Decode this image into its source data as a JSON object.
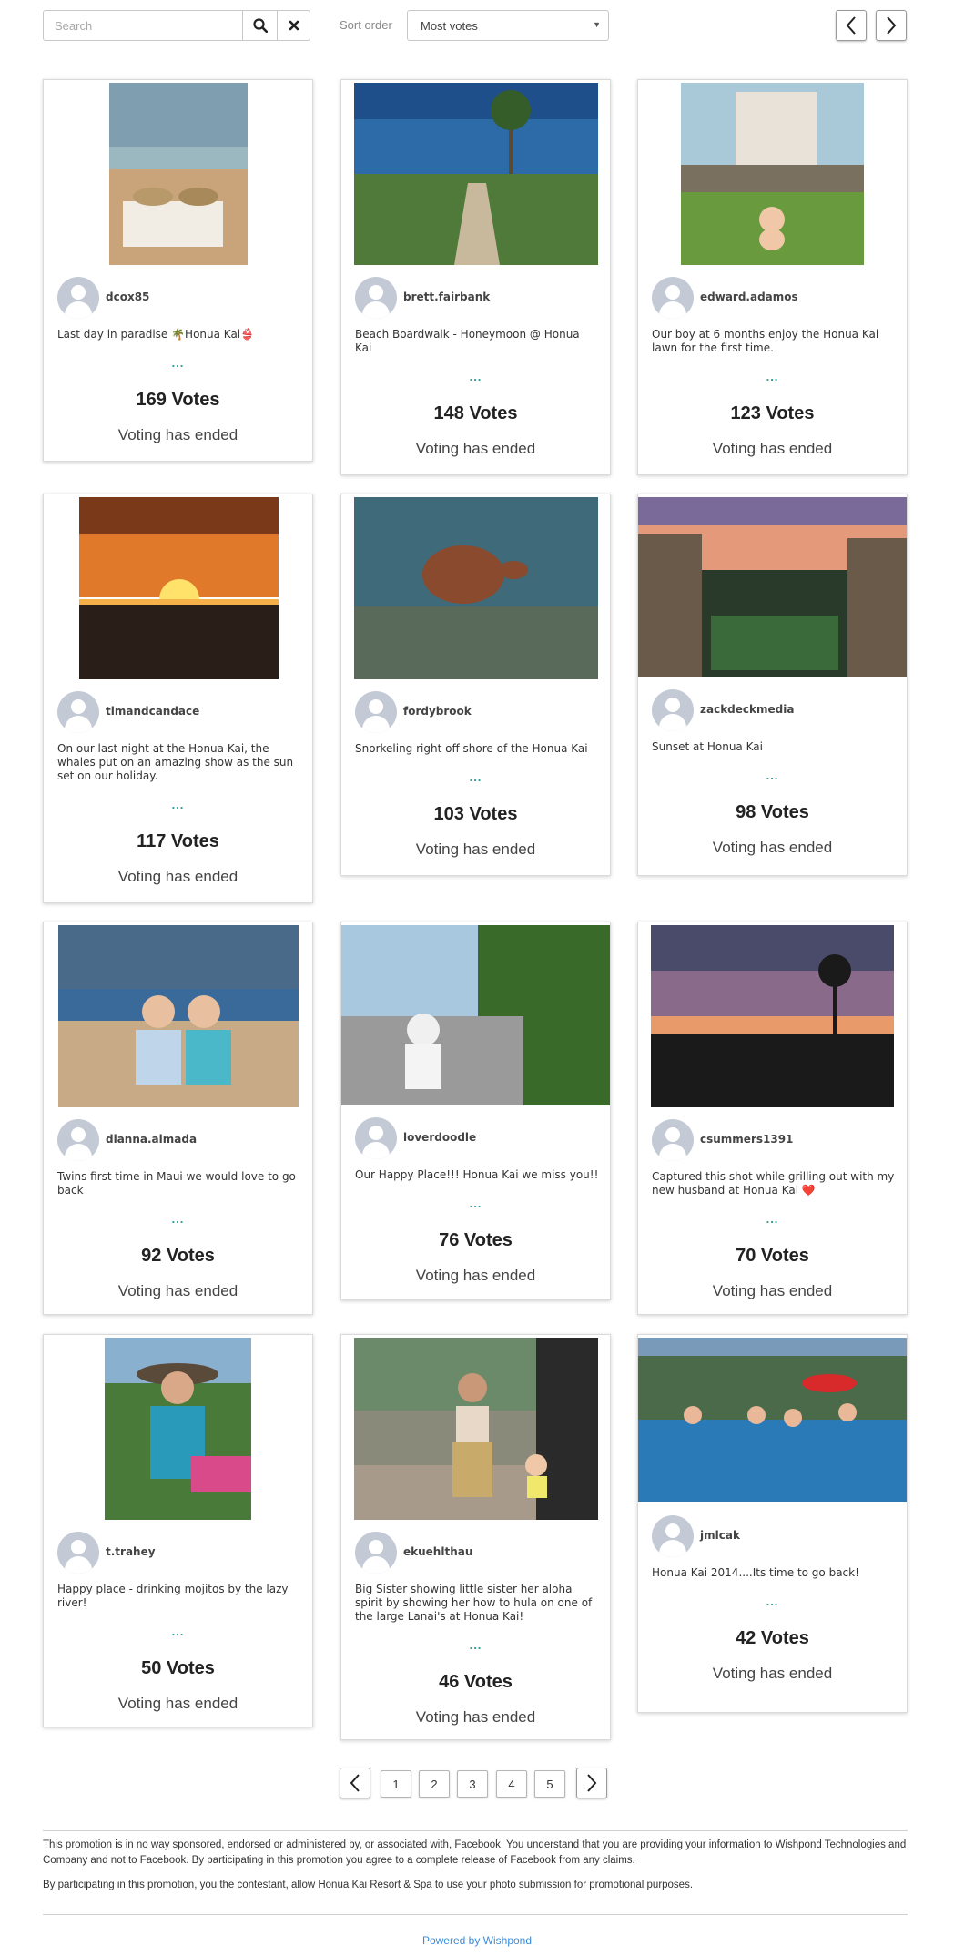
{
  "toolbar": {
    "search_placeholder": "Search",
    "sort_label": "Sort order",
    "sort_value": "Most votes"
  },
  "entries": [
    {
      "username": "dcox85",
      "caption": "Last day in paradise 🌴Honua Kai👙",
      "votes": "169 Votes",
      "status": "Voting has ended"
    },
    {
      "username": "brett.fairbank",
      "caption": "Beach Boardwalk - Honeymoon @ Honua Kai",
      "votes": "148 Votes",
      "status": "Voting has ended"
    },
    {
      "username": "edward.adamos",
      "caption": "Our boy at 6 months enjoy the Honua Kai lawn for the first time.",
      "votes": "123 Votes",
      "status": "Voting has ended"
    },
    {
      "username": "timandcandace",
      "caption": "On our last night at the Honua Kai, the whales put on an amazing show as the sun set on our holiday.",
      "votes": "117 Votes",
      "status": "Voting has ended"
    },
    {
      "username": "fordybrook",
      "caption": "Snorkeling right off shore of the Honua Kai",
      "votes": "103 Votes",
      "status": "Voting has ended"
    },
    {
      "username": "zackdeckmedia",
      "caption": "Sunset at Honua Kai",
      "votes": "98 Votes",
      "status": "Voting has ended"
    },
    {
      "username": "dianna.almada",
      "caption": "Twins first time in Maui we would love to go back",
      "votes": "92 Votes",
      "status": "Voting has ended"
    },
    {
      "username": "loverdoodle",
      "caption": "Our Happy Place!!! Honua Kai we miss you!!",
      "votes": "76 Votes",
      "status": "Voting has ended"
    },
    {
      "username": "csummers1391",
      "caption": "Captured this shot while grilling out with my new husband at Honua Kai ❤️",
      "votes": "70 Votes",
      "status": "Voting has ended"
    },
    {
      "username": "t.trahey",
      "caption": "Happy place - drinking mojitos by the lazy river!",
      "votes": "50 Votes",
      "status": "Voting has ended"
    },
    {
      "username": "ekuehlthau",
      "caption": "Big Sister showing little sister her aloha spirit by showing her how to hula on one of the large Lanai's at Honua Kai!",
      "votes": "46 Votes",
      "status": "Voting has ended"
    },
    {
      "username": "jmlcak",
      "caption": "Honua Kai 2014....Its time to go back!",
      "votes": "42 Votes",
      "status": "Voting has ended"
    }
  ],
  "more_indicator": "...",
  "pagination": [
    "1",
    "2",
    "3",
    "4",
    "5"
  ],
  "footer": {
    "disclaimer_1": "This promotion is in no way sponsored, endorsed or administered by, or associated with, Facebook. You understand that you are providing your information to Wishpond Technologies and Company and not to Facebook. By participating in this promotion you agree to a complete release of Facebook from any claims.",
    "disclaimer_2": "By participating in this promotion, you the contestant, allow Honua Kai Resort & Spa to use your photo submission for promotional purposes.",
    "powered_by": "Powered by Wishpond"
  },
  "colors": {
    "accent_teal": "#2a9d8f",
    "link_blue": "#3a8ddc",
    "avatar_gray": "#c3cad6"
  },
  "icons": {
    "search": "search-icon",
    "clear": "close-icon",
    "prev": "chevron-left-icon",
    "next": "chevron-right-icon"
  }
}
